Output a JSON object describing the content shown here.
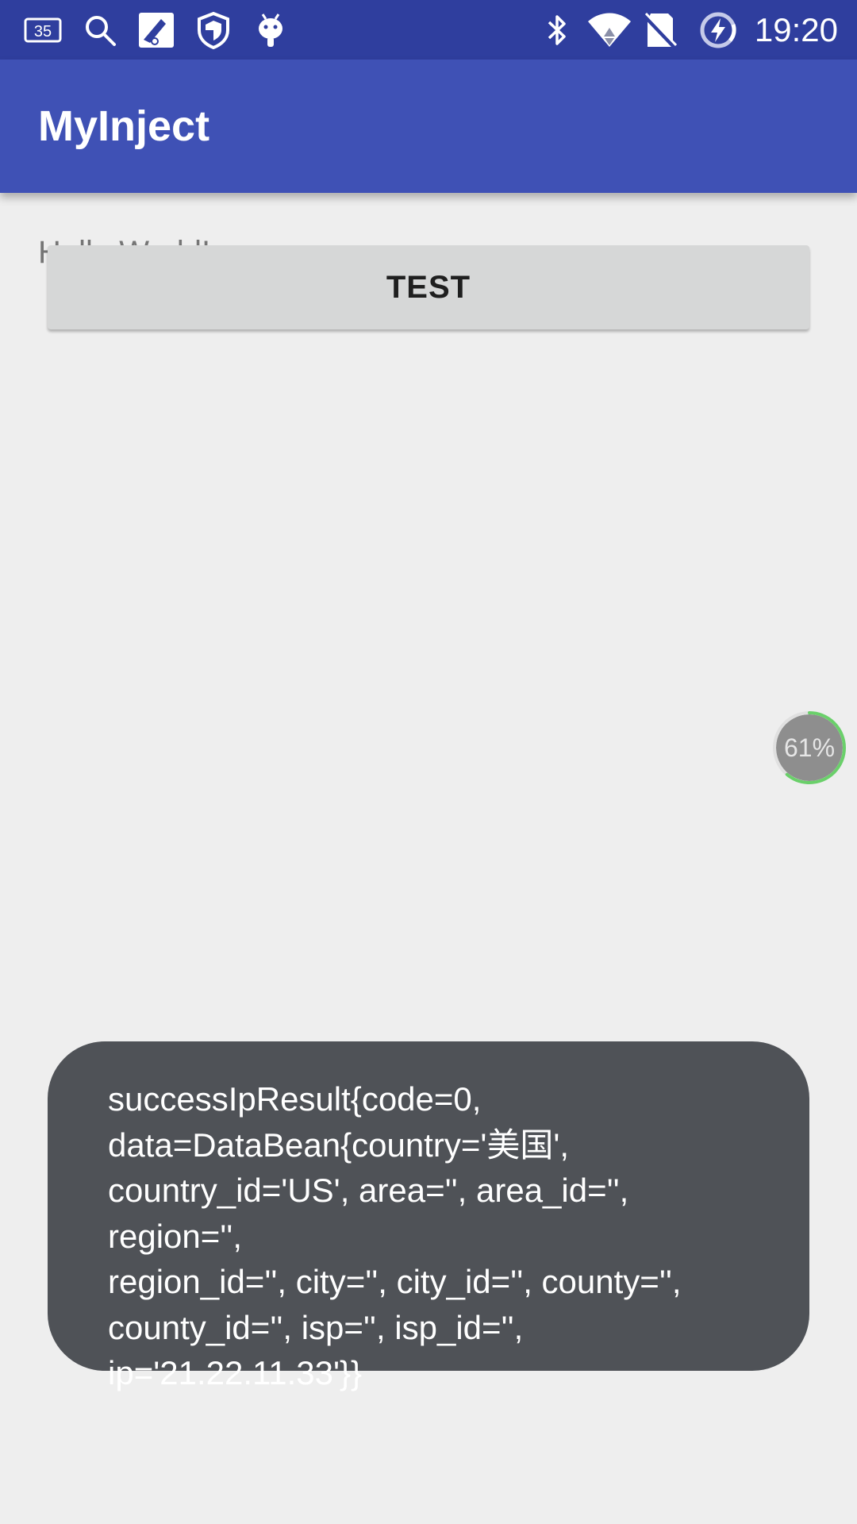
{
  "status_bar": {
    "notification_badge": "35",
    "time": "19:20",
    "icons": [
      "notification-count-icon",
      "search-icon",
      "app-notification-icon",
      "shield-icon",
      "android-icon",
      "bluetooth-icon",
      "wifi-icon",
      "no-sim-icon",
      "battery-saver-icon"
    ]
  },
  "app_bar": {
    "title": "MyInject"
  },
  "content": {
    "hello_text": "Hello World!",
    "test_button_label": "TEST"
  },
  "float_widget": {
    "progress_label": "61%",
    "progress_value": 0.61,
    "ring_color": "#6ad06a"
  },
  "toast": {
    "message": "successIpResult{code=0,\ndata=DataBean{country='美国',\ncountry_id='US', area='', area_id='', region='',\nregion_id='', city='', city_id='', county='',\ncounty_id='', isp='', isp_id='',\nip='21.22.11.33'}}"
  },
  "colors": {
    "status_bar": "#2f3e9e",
    "app_bar": "#3f51b5",
    "background": "#eeeeee",
    "button": "#d6d7d7",
    "toast": "#4f5257"
  }
}
